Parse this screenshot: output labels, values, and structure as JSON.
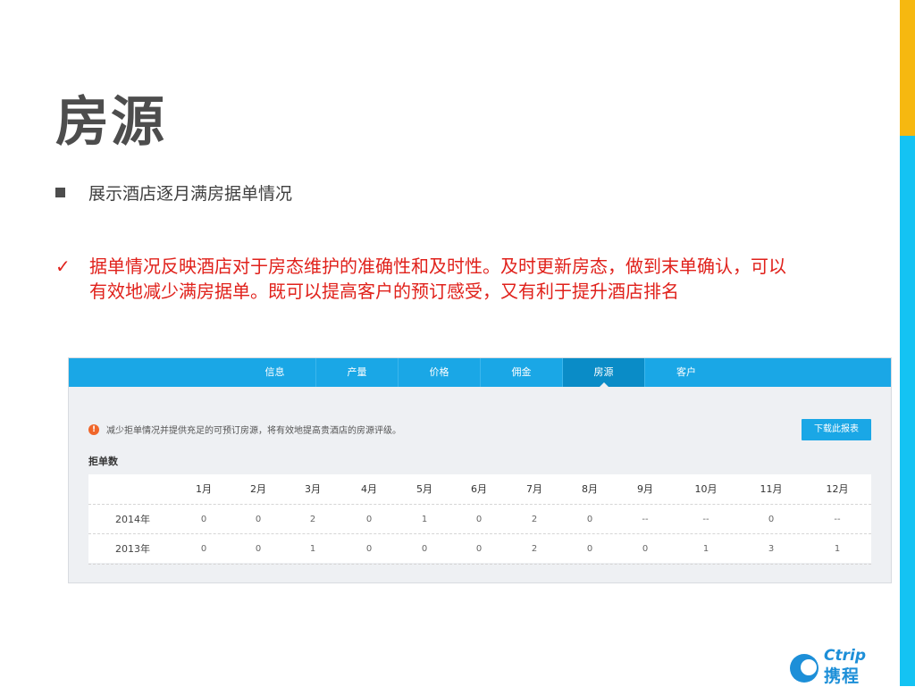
{
  "slide": {
    "title": "房源",
    "bullet": "展示酒店逐月满房据单情况",
    "check_mark": "✓",
    "note": "据单情况反映酒店对于房态维护的准确性和及时性。及时更新房态，做到末单确认，可以有效地减少满房据单。既可以提高客户的预订感受，又有利于提升酒店排名"
  },
  "screenshot": {
    "tabs": [
      {
        "label": "信息",
        "active": false
      },
      {
        "label": "产量",
        "active": false
      },
      {
        "label": "价格",
        "active": false
      },
      {
        "label": "佣金",
        "active": false
      },
      {
        "label": "房源",
        "active": true
      },
      {
        "label": "客户",
        "active": false
      }
    ],
    "notice_icon": "!",
    "notice": "减少拒单情况并提供充足的可预订房源，将有效地提高贵酒店的房源评级。",
    "download_label": "下载此报表",
    "section_label": "拒单数",
    "table": {
      "months": [
        "1月",
        "2月",
        "3月",
        "4月",
        "5月",
        "6月",
        "7月",
        "8月",
        "9月",
        "10月",
        "11月",
        "12月"
      ],
      "rows": [
        {
          "year": "2014年",
          "values": [
            "0",
            "0",
            "2",
            "0",
            "1",
            "0",
            "2",
            "0",
            "--",
            "--",
            "0",
            "--"
          ]
        },
        {
          "year": "2013年",
          "values": [
            "0",
            "0",
            "1",
            "0",
            "0",
            "0",
            "2",
            "0",
            "0",
            "1",
            "3",
            "1"
          ]
        }
      ]
    }
  },
  "logo": {
    "en": "Ctrip",
    "cn": "携程"
  },
  "colors": {
    "accent_yellow": "#f6b810",
    "accent_blue": "#14c3f3",
    "nav_blue": "#1aa7e6",
    "note_red": "#e0211b"
  }
}
